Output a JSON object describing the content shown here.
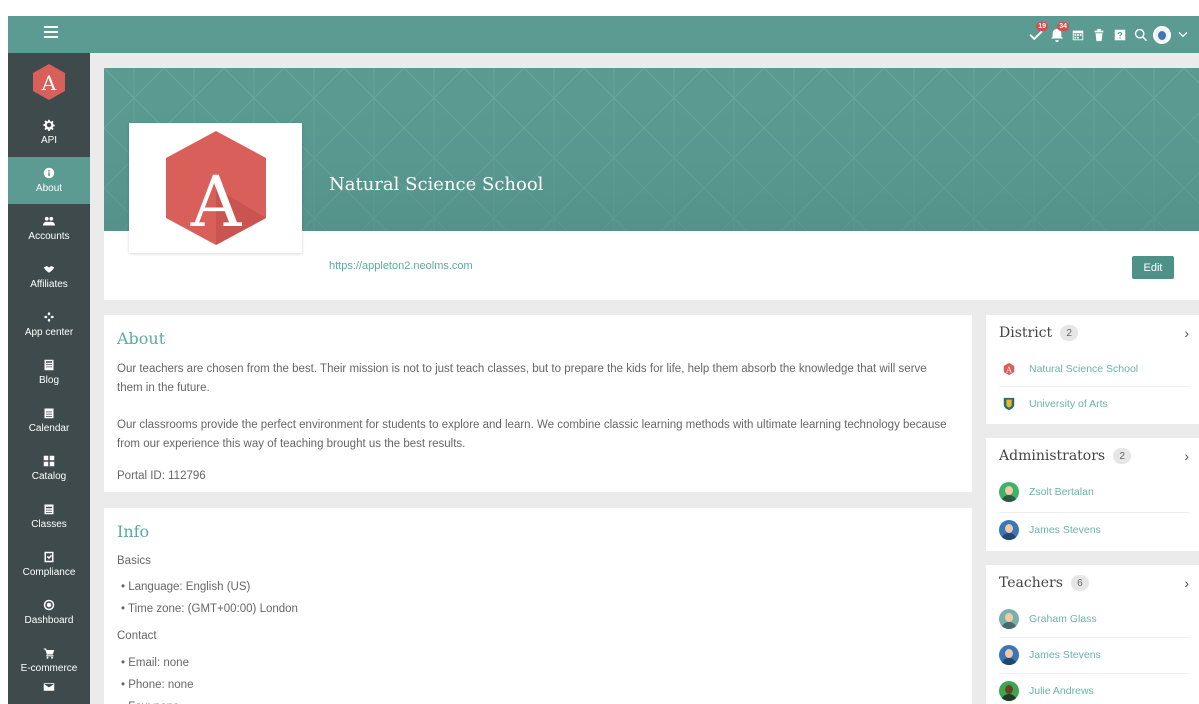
{
  "topbar": {
    "badges": {
      "tasks": "19",
      "notifications": "34"
    }
  },
  "sidebar": {
    "items": [
      {
        "label": "API",
        "icon": "gear-icon"
      },
      {
        "label": "About",
        "icon": "info-icon",
        "active": true
      },
      {
        "label": "Accounts",
        "icon": "users-icon"
      },
      {
        "label": "Affiliates",
        "icon": "handshake-icon"
      },
      {
        "label": "App center",
        "icon": "puzzle-icon"
      },
      {
        "label": "Blog",
        "icon": "blog-icon"
      },
      {
        "label": "Calendar",
        "icon": "calendar-icon"
      },
      {
        "label": "Catalog",
        "icon": "grid-icon"
      },
      {
        "label": "Classes",
        "icon": "classes-icon"
      },
      {
        "label": "Compliance",
        "icon": "check-icon"
      },
      {
        "label": "Dashboard",
        "icon": "dashboard-icon"
      },
      {
        "label": "E-commerce",
        "icon": "cart-icon"
      }
    ]
  },
  "hero": {
    "school_name": "Natural Science School",
    "url": "https://appleton2.neolms.com",
    "edit_label": "Edit"
  },
  "about": {
    "title": "About",
    "paragraph1": "Our teachers are chosen from the best. Their mission is not to just teach classes, but to prepare the kids for life, help them absorb the knowledge that will serve them in the future.",
    "paragraph2": "Our classrooms provide the perfect environment for students to explore and learn. We combine classic learning methods with ultimate learning technology because from our experience this way of teaching brought us the best results.",
    "portal_id": "Portal ID: 112796"
  },
  "info": {
    "title": "Info",
    "basics_label": "Basics",
    "basics": [
      "Language: English (US)",
      "Time zone: (GMT+00:00) London"
    ],
    "contact_label": "Contact",
    "contact": [
      "Email: none",
      "Phone: none",
      "Fax: none"
    ]
  },
  "district": {
    "title": "District",
    "count": "2",
    "items": [
      "Natural Science School",
      "University of Arts"
    ]
  },
  "administrators": {
    "title": "Administrators",
    "count": "2",
    "items": [
      "Zsolt Bertalan",
      "James Stevens"
    ]
  },
  "teachers": {
    "title": "Teachers",
    "count": "6",
    "items": [
      "Graham Glass",
      "James Stevens",
      "Julie Andrews"
    ]
  },
  "colors": {
    "accent": "#5b9b92",
    "sidebar": "#3f4a4c",
    "link": "#6ab3a8",
    "logo": "#d9605a"
  }
}
